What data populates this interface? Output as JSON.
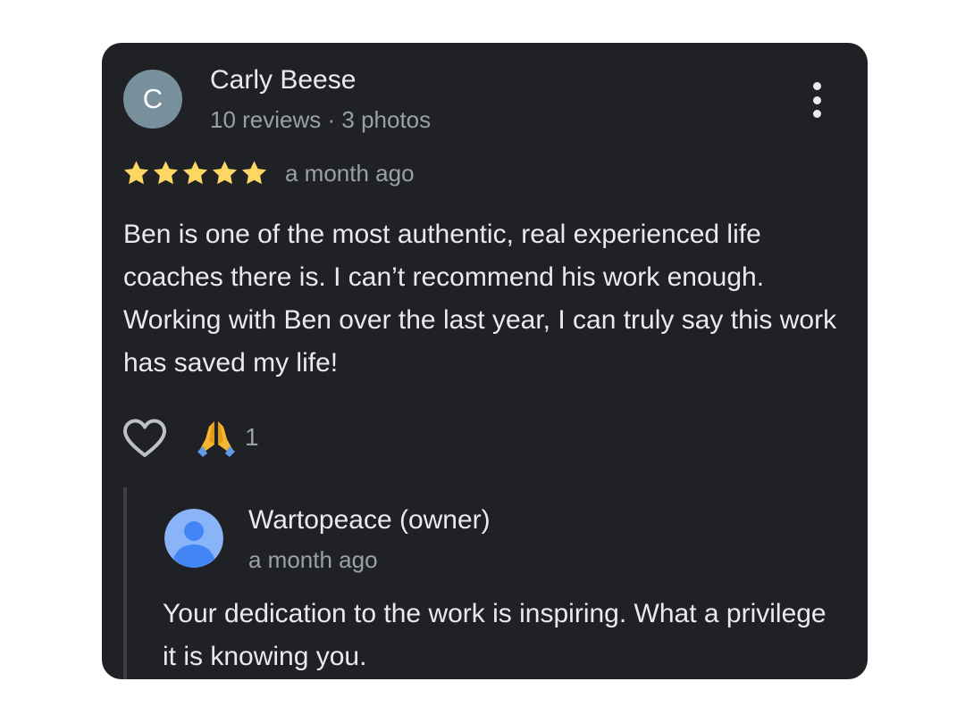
{
  "review": {
    "avatar_letter": "C",
    "avatar_color": "#78909c",
    "reviewer_name": "Carly Beese",
    "reviewer_meta": "10 reviews · 3 photos",
    "rating": 5,
    "rating_max": 5,
    "star_color": "#fdd663",
    "date": "a month ago",
    "text": "Ben is one of the most authentic, real experienced life coaches there is. I can’t recommend his work enough. Working with Ben over the last year, I can truly say this work has saved my life!",
    "more_icon": "more-vert-icon",
    "like_icon": "heart-outline-icon",
    "reaction_icon": "folded-hands-icon",
    "reaction_count": "1"
  },
  "owner_reply": {
    "avatar_icon": "default-person-avatar-icon",
    "avatar_color": "#8ab4f8",
    "name": "Wartopeace (owner)",
    "date": "a month ago",
    "text": "Your dedication to the work is inspiring. What a privilege it is knowing you."
  },
  "colors": {
    "card_background": "#202124",
    "primary_text": "#e8eaed",
    "secondary_text": "#9aa0a6"
  }
}
